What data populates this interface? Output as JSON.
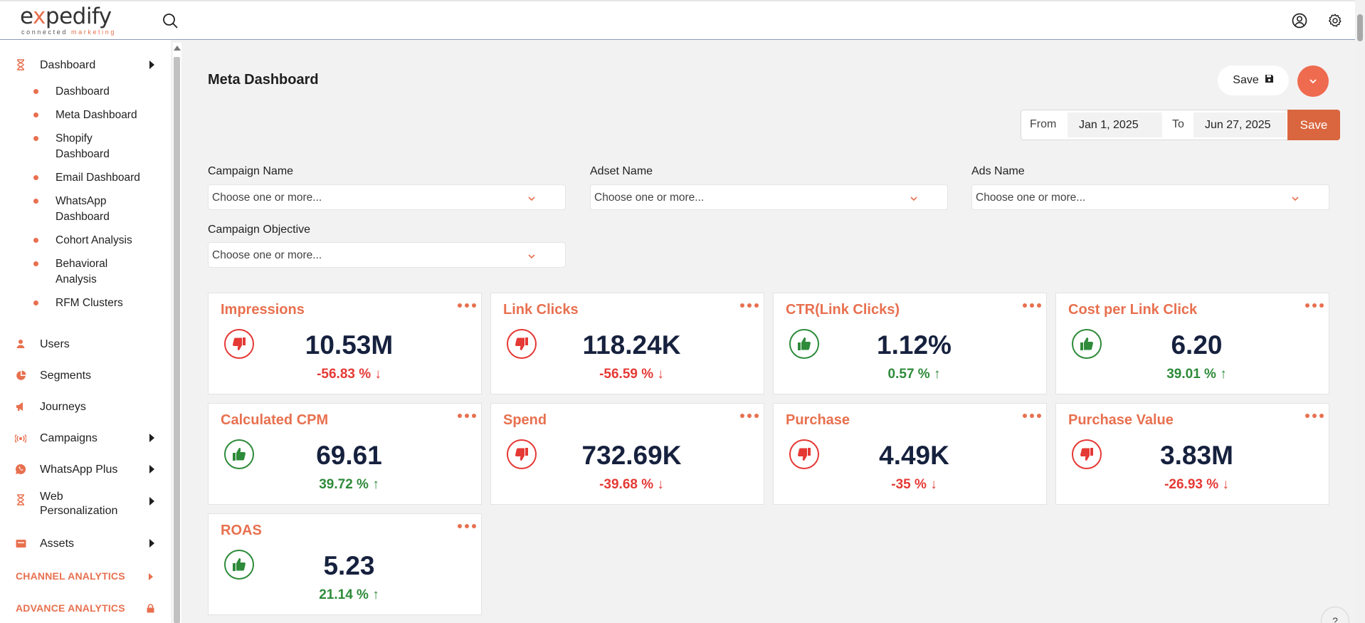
{
  "brand": {
    "logo_main_a": "e",
    "logo_main_x": "x",
    "logo_main_b": "pedify",
    "logo_sub_a": "connected",
    "logo_sub_b": "marketing"
  },
  "header": {
    "search_icon": "search-icon",
    "profile_icon": "user-circle-icon",
    "settings_icon": "gear-icon"
  },
  "sidebar": {
    "dashboard_label": "Dashboard",
    "sub_items": [
      {
        "label": "Dashboard"
      },
      {
        "label": "Meta Dashboard"
      },
      {
        "label": "Shopify Dashboard"
      },
      {
        "label": "Email Dashboard"
      },
      {
        "label": "WhatsApp Dashboard"
      },
      {
        "label": "Cohort Analysis"
      },
      {
        "label": "Behavioral Analysis"
      },
      {
        "label": "RFM Clusters"
      }
    ],
    "items": [
      {
        "label": "Users"
      },
      {
        "label": "Segments"
      },
      {
        "label": "Journeys"
      },
      {
        "label": "Campaigns"
      },
      {
        "label": "WhatsApp Plus"
      },
      {
        "label": "Web Personalization"
      },
      {
        "label": "Assets"
      }
    ],
    "channel_analytics": "CHANNEL ANALYTICS",
    "advance_analytics": "ADVANCE ANALYTICS"
  },
  "main": {
    "title": "Meta Dashboard",
    "save_label": "Save",
    "date_range": {
      "from_label": "From",
      "from_value": "Jan 1, 2025",
      "to_label": "To",
      "to_value": "Jun 27, 2025",
      "save_label": "Save"
    },
    "filters": [
      {
        "label": "Campaign Name",
        "placeholder": "Choose one or more..."
      },
      {
        "label": "Adset Name",
        "placeholder": "Choose one or more..."
      },
      {
        "label": "Ads Name",
        "placeholder": "Choose one or more..."
      },
      {
        "label": "Campaign Objective",
        "placeholder": "Choose one or more..."
      }
    ],
    "cards": [
      {
        "title": "Impressions",
        "value": "10.53M",
        "change": "-56.83 %",
        "trend": "down"
      },
      {
        "title": "Link Clicks",
        "value": "118.24K",
        "change": "-56.59 %",
        "trend": "down"
      },
      {
        "title": "CTR(Link Clicks)",
        "value": "1.12%",
        "change": "0.57 %",
        "trend": "up"
      },
      {
        "title": "Cost per Link Click",
        "value": "6.20",
        "change": "39.01 %",
        "trend": "up"
      },
      {
        "title": "Calculated CPM",
        "value": "69.61",
        "change": "39.72 %",
        "trend": "up"
      },
      {
        "title": "Spend",
        "value": "732.69K",
        "change": "-39.68 %",
        "trend": "down"
      },
      {
        "title": "Purchase",
        "value": "4.49K",
        "change": "-35 %",
        "trend": "down"
      },
      {
        "title": "Purchase Value",
        "value": "3.83M",
        "change": "-26.93 %",
        "trend": "down"
      },
      {
        "title": "ROAS",
        "value": "5.23",
        "change": "21.14 %",
        "trend": "up"
      }
    ],
    "help_label": "?"
  },
  "colors": {
    "accent": "#e8704f",
    "negative": "#e53935",
    "positive": "#2e8b3a",
    "value_text": "#16213e"
  }
}
